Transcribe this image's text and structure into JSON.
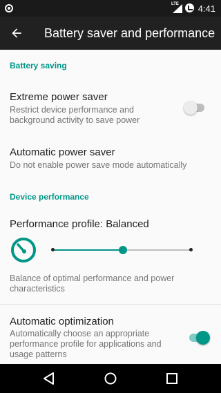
{
  "status_bar": {
    "network_label": "LTE",
    "time": "4:41"
  },
  "app_bar": {
    "back_icon": "arrow-back-icon",
    "title": "Battery saver and performance"
  },
  "sections": {
    "battery_saving": {
      "header": "Battery saving",
      "extreme_power_saver": {
        "title": "Extreme power saver",
        "subtitle": "Restrict device performance and background activity to save power",
        "enabled": false
      },
      "automatic_power_saver": {
        "title": "Automatic power saver",
        "subtitle": "Do not enable power save mode automatically"
      }
    },
    "device_performance": {
      "header": "Device performance",
      "performance_profile": {
        "title": "Performance profile: Balanced",
        "icon": "speedometer-icon",
        "slider_levels": 3,
        "slider_selected_index": 1,
        "description": "Balance of optimal performance and power characteristics"
      },
      "automatic_optimization": {
        "title": "Automatic optimization",
        "subtitle": "Automatically choose an appropriate performance profile for applications and usage patterns",
        "enabled": true
      }
    }
  },
  "nav_bar": {
    "back": "nav-back-icon",
    "home": "nav-home-icon",
    "recents": "nav-recents-icon"
  },
  "colors": {
    "accent": "#009688",
    "switch_on_track": "#80cbc4",
    "switch_off_track": "#bdbdbd",
    "switch_off_thumb": "#ececec"
  }
}
